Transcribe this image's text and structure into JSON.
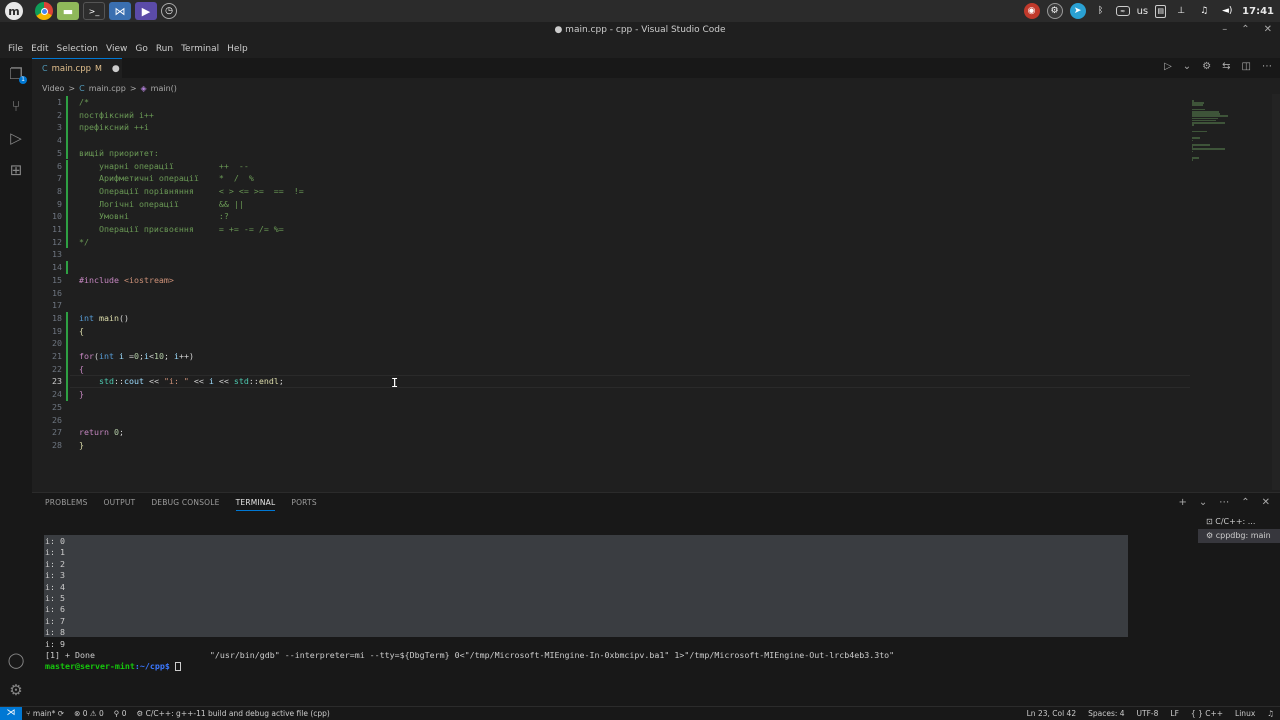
{
  "system": {
    "clock": "17:41",
    "keyboard_layout": "us",
    "launcher_icons": [
      "mint-menu-icon",
      "chrome-icon",
      "files-icon",
      "terminal-icon",
      "vscode-icon",
      "media-player-icon",
      "timeshift-icon"
    ],
    "tray_icons": [
      "obs-icon",
      "steam-icon",
      "telegram-icon",
      "bluetooth-icon",
      "network-icon",
      "clipboard-icon",
      "network-tree-icon",
      "music-icon",
      "volume-icon"
    ]
  },
  "window": {
    "title": "● main.cpp - cpp - Visual Studio Code"
  },
  "menu": [
    "File",
    "Edit",
    "Selection",
    "View",
    "Go",
    "Run",
    "Terminal",
    "Help"
  ],
  "activity": {
    "source_control_badge": "1",
    "accent": "#0078d4"
  },
  "tab": {
    "name": "main.cpp",
    "status": "M",
    "dirty": "●"
  },
  "breadcrumb": {
    "folder": "Video",
    "file": "main.cpp",
    "symbol": "main()",
    "sep": ">"
  },
  "editor": {
    "active_line": 23,
    "lines": [
      [
        {
          "t": "/*",
          "c": "comment"
        }
      ],
      [
        {
          "t": "постфіксний i++",
          "c": "comment"
        }
      ],
      [
        {
          "t": "префіксний ++i",
          "c": "comment"
        }
      ],
      [],
      [
        {
          "t": "вищій приоритет:",
          "c": "comment"
        }
      ],
      [
        {
          "t": "    унарні операції         ++  --",
          "c": "comment"
        }
      ],
      [
        {
          "t": "    Арифметичні операції    *  /  %",
          "c": "comment"
        }
      ],
      [
        {
          "t": "    Операції порівняння     < > <= >=  ==  !=",
          "c": "comment"
        }
      ],
      [
        {
          "t": "    Логічні операції        && ||",
          "c": "comment"
        }
      ],
      [
        {
          "t": "    Умовні                  :?",
          "c": "comment"
        }
      ],
      [
        {
          "t": "    Операції присвоєння     = += -= /= %=",
          "c": "comment"
        }
      ],
      [
        {
          "t": "*/",
          "c": "comment"
        }
      ],
      [],
      [],
      [
        {
          "t": "#include ",
          "c": "ctrl"
        },
        {
          "t": "<iostream>",
          "c": "str"
        }
      ],
      [],
      [],
      [
        {
          "t": "int ",
          "c": "kw"
        },
        {
          "t": "main",
          "c": "fn"
        },
        {
          "t": "()",
          "c": "plain"
        }
      ],
      [
        {
          "t": "{",
          "c": "fn"
        }
      ],
      [],
      [
        {
          "t": "for",
          "c": "ctrl"
        },
        {
          "t": "(",
          "c": "plain"
        },
        {
          "t": "int ",
          "c": "kw"
        },
        {
          "t": "i",
          "c": "id"
        },
        {
          "t": " =",
          "c": "plain"
        },
        {
          "t": "0",
          "c": "num"
        },
        {
          "t": ";",
          "c": "plain"
        },
        {
          "t": "i",
          "c": "id"
        },
        {
          "t": "<",
          "c": "plain"
        },
        {
          "t": "10",
          "c": "num"
        },
        {
          "t": "; ",
          "c": "plain"
        },
        {
          "t": "i",
          "c": "id"
        },
        {
          "t": "++)",
          "c": "plain"
        }
      ],
      [
        {
          "t": "{",
          "c": "ctrl"
        }
      ],
      [
        {
          "t": "    ",
          "c": "plain"
        },
        {
          "t": "std",
          "c": "ns"
        },
        {
          "t": "::",
          "c": "plain"
        },
        {
          "t": "cout",
          "c": "id"
        },
        {
          "t": " << ",
          "c": "plain"
        },
        {
          "t": "\"i: \"",
          "c": "str"
        },
        {
          "t": " << ",
          "c": "plain"
        },
        {
          "t": "i",
          "c": "id"
        },
        {
          "t": " << ",
          "c": "plain"
        },
        {
          "t": "std",
          "c": "ns"
        },
        {
          "t": "::",
          "c": "plain"
        },
        {
          "t": "endl",
          "c": "fn"
        },
        {
          "t": ";",
          "c": "plain"
        }
      ],
      [
        {
          "t": "}",
          "c": "ctrl"
        }
      ],
      [],
      [],
      [
        {
          "t": "return ",
          "c": "ctrl"
        },
        {
          "t": "0",
          "c": "num"
        },
        {
          "t": ";",
          "c": "plain"
        }
      ],
      [
        {
          "t": "}",
          "c": "fn"
        }
      ]
    ]
  },
  "panel": {
    "tabs": [
      "PROBLEMS",
      "OUTPUT",
      "DEBUG CONSOLE",
      "TERMINAL",
      "PORTS"
    ],
    "active_tab": "TERMINAL",
    "terminal_output": [
      "i: 0",
      "i: 1",
      "i: 2",
      "i: 3",
      "i: 4",
      "i: 5",
      "i: 6",
      "i: 7",
      "i: 8",
      "i: 9"
    ],
    "done_line": "[1] + Done                       \"/usr/bin/gdb\" --interpreter=mi --tty=${DbgTerm} 0<\"/tmp/Microsoft-MIEngine-In-0xbmcipv.ba1\" 1>\"/tmp/Microsoft-MIEngine-Out-lrcb4eb3.3to\"",
    "prompt_user": "master@server-mint",
    "prompt_path": ":~/cpp$ ",
    "terminals": [
      "C/C++: ...",
      "cppdbg: main"
    ]
  },
  "status": {
    "branch": "main*",
    "errors": "0",
    "warnings": "0",
    "ports": "0",
    "task": "C/C++: g++-11 build and debug active file (cpp)",
    "position": "Ln 23, Col 42",
    "spaces": "Spaces: 4",
    "encoding": "UTF-8",
    "eol": "LF",
    "language": "C++",
    "os": "Linux"
  }
}
